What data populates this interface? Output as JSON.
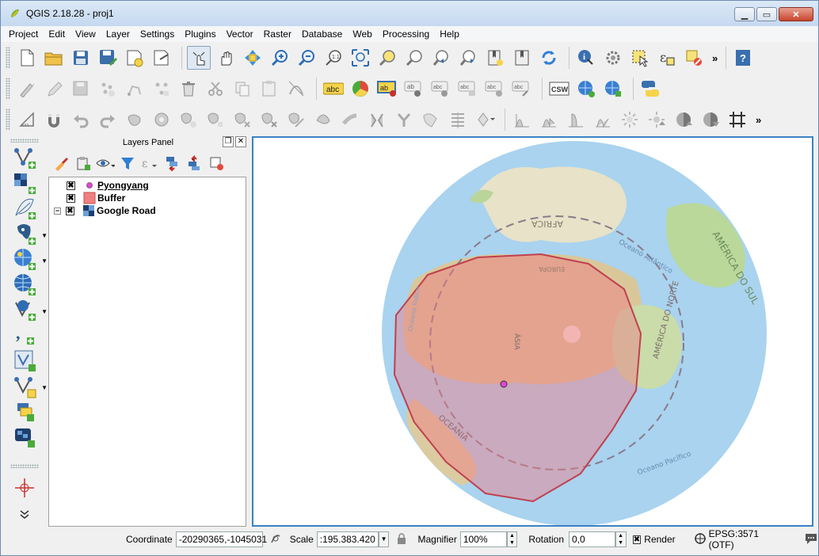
{
  "window": {
    "title": "QGIS 2.18.28 - proj1",
    "buttons": {
      "minimize": "▁",
      "maximize": "▭",
      "close": "✕"
    }
  },
  "menu": [
    "Project",
    "Edit",
    "View",
    "Layer",
    "Settings",
    "Plugins",
    "Vector",
    "Raster",
    "Database",
    "Web",
    "Processing",
    "Help"
  ],
  "toolbars": {
    "row1": [
      "new-project-icon",
      "open-project-icon",
      "save-project-icon",
      "save-as-icon",
      "new-print-composer-icon",
      "composer-manager-icon",
      "touch-zoom-icon",
      "pan-icon",
      "pan-to-selection-icon",
      "zoom-in-icon",
      "zoom-out-icon",
      "zoom-native-icon",
      "zoom-full-icon",
      "zoom-to-selection-icon",
      "zoom-to-layer-icon",
      "zoom-last-icon",
      "zoom-next-icon",
      "new-bookmark-icon",
      "show-bookmarks-icon",
      "refresh-icon",
      "identify-icon",
      "measure-icon",
      "select-features-icon",
      "expression-select-icon",
      "deselect-icon",
      "help-icon"
    ],
    "row2": [
      "current-edits-icon",
      "toggle-editing-icon",
      "save-edits-icon",
      "add-feature-icon",
      "move-feature-icon",
      "node-tool-icon",
      "delete-selected-icon",
      "cut-features-icon",
      "copy-features-icon",
      "paste-features-icon",
      "digitize-curve-icon",
      "label-icon",
      "diagram-icon",
      "label-pin-icon",
      "label-show-icon",
      "label-move-icon",
      "label-rotate-icon",
      "label-change-icon",
      "csw-icon",
      "metasearch-icon",
      "add-wms-icon",
      "python-icon"
    ],
    "row3": [
      "measure-line-icon",
      "magnet-icon",
      "undo-icon",
      "redo-icon",
      "simplify-icon",
      "add-ring-icon",
      "add-part-icon",
      "fill-ring-icon",
      "delete-ring-icon",
      "delete-part-icon",
      "reshape-icon",
      "offset-curve-icon",
      "split-features-icon",
      "split-parts-icon",
      "merge-icon",
      "merge-attributes-icon",
      "rotate-point-icon",
      "raster-histogram-icon",
      "raster-stretch-icon",
      "raster-cumulative-icon",
      "raster-local-icon",
      "brightness-icon",
      "contrast-icon",
      "select-raster-icon",
      "grid-icon"
    ],
    "more": "»",
    "csw_label": "CSW",
    "label_abc": "abc"
  },
  "left_toolbar": [
    "add-vector-layer-icon",
    "add-raster-layer-icon",
    "add-spatialite-icon",
    "add-postgis-icon",
    "add-mssql-icon",
    "add-wms-layer-icon",
    "add-wfs-layer-icon",
    "add-delimited-text-icon",
    "new-shapefile-icon",
    "new-spatialite-icon",
    "add-virtual-layer-icon",
    "add-oracle-icon",
    "crosshair-icon"
  ],
  "layers_panel": {
    "title": "Layers Panel",
    "layers": [
      {
        "name": "Pyongyang",
        "checked": "✖",
        "underline": true
      },
      {
        "name": "Buffer",
        "checked": "✖"
      },
      {
        "name": "Google Road",
        "checked": "✖"
      }
    ]
  },
  "map": {
    "labels": {
      "africa": "AFRICA",
      "south_america": "AMÉRICA DO SUL",
      "north_america": "AMÉRICA DO NORTE",
      "asia": "ÁSIA",
      "europe": "EUROPA",
      "oceania": "OCEANIA",
      "atlantic": "Oceano Atlântico",
      "pacific": "Oceano Pacífico",
      "indian": "Oceano Índico"
    }
  },
  "status": {
    "coordinate_label": "Coordinate",
    "coordinate_value": "-20290365,-1045031",
    "scale_label": "Scale",
    "scale_value": ":195.383.420",
    "magnifier_label": "Magnifier",
    "magnifier_value": "100%",
    "rotation_label": "Rotation",
    "rotation_value": "0,0",
    "render_label": "Render",
    "render_checked": "✖",
    "crs_label": "EPSG:3571 (OTF)"
  }
}
